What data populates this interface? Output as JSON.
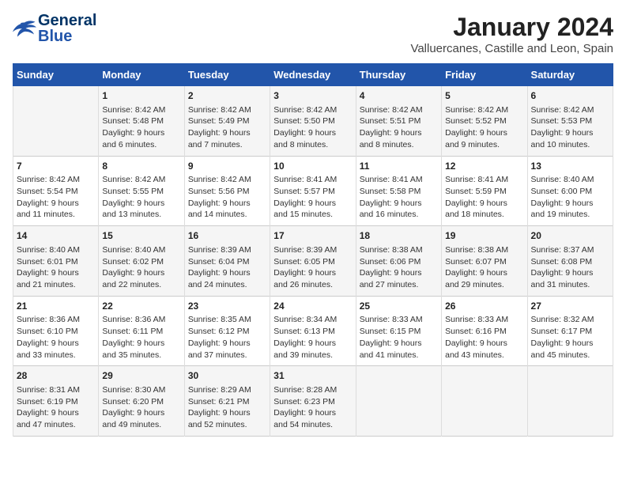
{
  "header": {
    "logo_line1": "General",
    "logo_line2": "Blue",
    "main_title": "January 2024",
    "subtitle": "Valluercanes, Castille and Leon, Spain"
  },
  "columns": [
    "Sunday",
    "Monday",
    "Tuesday",
    "Wednesday",
    "Thursday",
    "Friday",
    "Saturday"
  ],
  "weeks": [
    [
      {
        "day": "",
        "info": ""
      },
      {
        "day": "1",
        "info": "Sunrise: 8:42 AM\nSunset: 5:48 PM\nDaylight: 9 hours\nand 6 minutes."
      },
      {
        "day": "2",
        "info": "Sunrise: 8:42 AM\nSunset: 5:49 PM\nDaylight: 9 hours\nand 7 minutes."
      },
      {
        "day": "3",
        "info": "Sunrise: 8:42 AM\nSunset: 5:50 PM\nDaylight: 9 hours\nand 8 minutes."
      },
      {
        "day": "4",
        "info": "Sunrise: 8:42 AM\nSunset: 5:51 PM\nDaylight: 9 hours\nand 8 minutes."
      },
      {
        "day": "5",
        "info": "Sunrise: 8:42 AM\nSunset: 5:52 PM\nDaylight: 9 hours\nand 9 minutes."
      },
      {
        "day": "6",
        "info": "Sunrise: 8:42 AM\nSunset: 5:53 PM\nDaylight: 9 hours\nand 10 minutes."
      }
    ],
    [
      {
        "day": "7",
        "info": "Sunrise: 8:42 AM\nSunset: 5:54 PM\nDaylight: 9 hours\nand 11 minutes."
      },
      {
        "day": "8",
        "info": "Sunrise: 8:42 AM\nSunset: 5:55 PM\nDaylight: 9 hours\nand 13 minutes."
      },
      {
        "day": "9",
        "info": "Sunrise: 8:42 AM\nSunset: 5:56 PM\nDaylight: 9 hours\nand 14 minutes."
      },
      {
        "day": "10",
        "info": "Sunrise: 8:41 AM\nSunset: 5:57 PM\nDaylight: 9 hours\nand 15 minutes."
      },
      {
        "day": "11",
        "info": "Sunrise: 8:41 AM\nSunset: 5:58 PM\nDaylight: 9 hours\nand 16 minutes."
      },
      {
        "day": "12",
        "info": "Sunrise: 8:41 AM\nSunset: 5:59 PM\nDaylight: 9 hours\nand 18 minutes."
      },
      {
        "day": "13",
        "info": "Sunrise: 8:40 AM\nSunset: 6:00 PM\nDaylight: 9 hours\nand 19 minutes."
      }
    ],
    [
      {
        "day": "14",
        "info": "Sunrise: 8:40 AM\nSunset: 6:01 PM\nDaylight: 9 hours\nand 21 minutes."
      },
      {
        "day": "15",
        "info": "Sunrise: 8:40 AM\nSunset: 6:02 PM\nDaylight: 9 hours\nand 22 minutes."
      },
      {
        "day": "16",
        "info": "Sunrise: 8:39 AM\nSunset: 6:04 PM\nDaylight: 9 hours\nand 24 minutes."
      },
      {
        "day": "17",
        "info": "Sunrise: 8:39 AM\nSunset: 6:05 PM\nDaylight: 9 hours\nand 26 minutes."
      },
      {
        "day": "18",
        "info": "Sunrise: 8:38 AM\nSunset: 6:06 PM\nDaylight: 9 hours\nand 27 minutes."
      },
      {
        "day": "19",
        "info": "Sunrise: 8:38 AM\nSunset: 6:07 PM\nDaylight: 9 hours\nand 29 minutes."
      },
      {
        "day": "20",
        "info": "Sunrise: 8:37 AM\nSunset: 6:08 PM\nDaylight: 9 hours\nand 31 minutes."
      }
    ],
    [
      {
        "day": "21",
        "info": "Sunrise: 8:36 AM\nSunset: 6:10 PM\nDaylight: 9 hours\nand 33 minutes."
      },
      {
        "day": "22",
        "info": "Sunrise: 8:36 AM\nSunset: 6:11 PM\nDaylight: 9 hours\nand 35 minutes."
      },
      {
        "day": "23",
        "info": "Sunrise: 8:35 AM\nSunset: 6:12 PM\nDaylight: 9 hours\nand 37 minutes."
      },
      {
        "day": "24",
        "info": "Sunrise: 8:34 AM\nSunset: 6:13 PM\nDaylight: 9 hours\nand 39 minutes."
      },
      {
        "day": "25",
        "info": "Sunrise: 8:33 AM\nSunset: 6:15 PM\nDaylight: 9 hours\nand 41 minutes."
      },
      {
        "day": "26",
        "info": "Sunrise: 8:33 AM\nSunset: 6:16 PM\nDaylight: 9 hours\nand 43 minutes."
      },
      {
        "day": "27",
        "info": "Sunrise: 8:32 AM\nSunset: 6:17 PM\nDaylight: 9 hours\nand 45 minutes."
      }
    ],
    [
      {
        "day": "28",
        "info": "Sunrise: 8:31 AM\nSunset: 6:19 PM\nDaylight: 9 hours\nand 47 minutes."
      },
      {
        "day": "29",
        "info": "Sunrise: 8:30 AM\nSunset: 6:20 PM\nDaylight: 9 hours\nand 49 minutes."
      },
      {
        "day": "30",
        "info": "Sunrise: 8:29 AM\nSunset: 6:21 PM\nDaylight: 9 hours\nand 52 minutes."
      },
      {
        "day": "31",
        "info": "Sunrise: 8:28 AM\nSunset: 6:23 PM\nDaylight: 9 hours\nand 54 minutes."
      },
      {
        "day": "",
        "info": ""
      },
      {
        "day": "",
        "info": ""
      },
      {
        "day": "",
        "info": ""
      }
    ]
  ]
}
